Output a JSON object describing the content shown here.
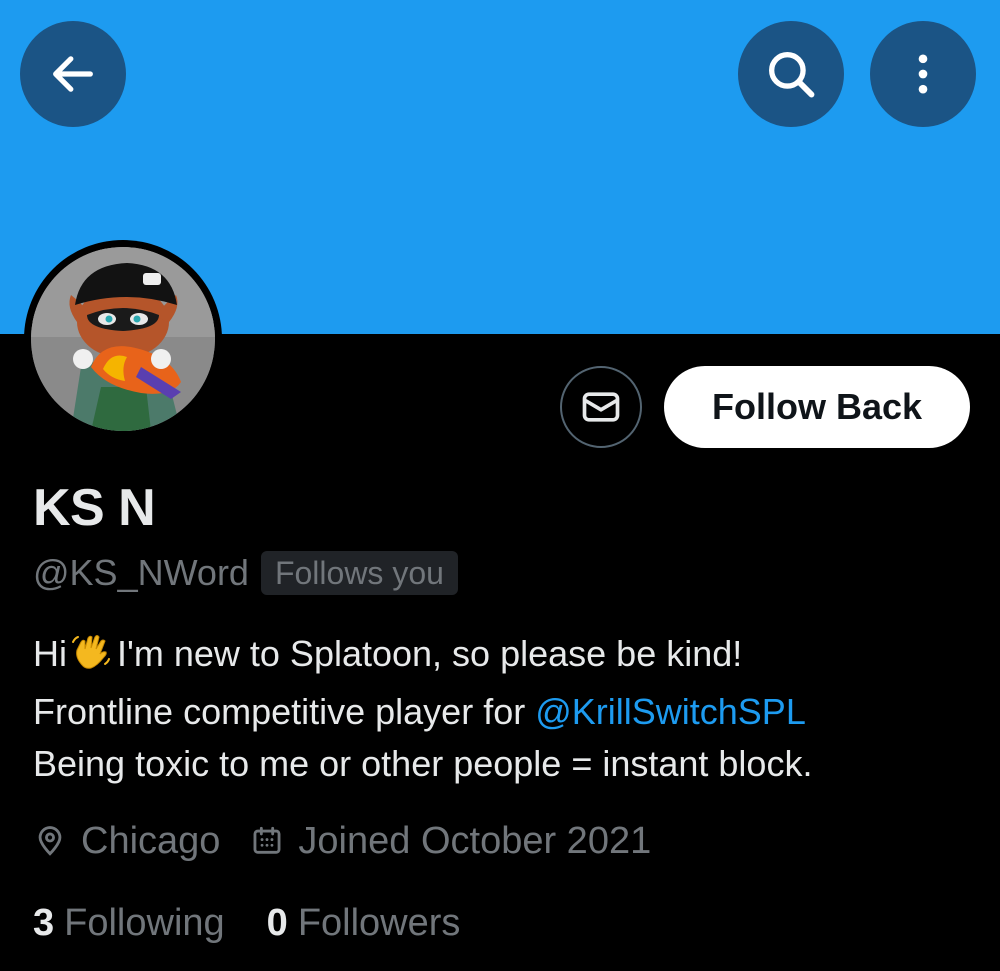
{
  "header": {
    "back_icon": "arrow-left-icon",
    "search_icon": "search-icon",
    "more_icon": "more-vertical-icon",
    "banner_color": "#1d9bf0"
  },
  "profile": {
    "display_name": "KS N",
    "handle": "@KS_NWord",
    "follows_you_badge": "Follows you",
    "follow_button_label": "Follow Back",
    "message_icon": "envelope-icon",
    "bio": {
      "line1_prefix": "Hi",
      "line1_emoji": "waving-hand-icon",
      "line1_suffix": "I'm new to Splatoon, so please be kind!",
      "line2_prefix": "Frontline competitive player for ",
      "line2_mention": "@KrillSwitchSPL",
      "line3": "Being toxic to me or other people = instant block."
    },
    "location": "Chicago",
    "joined": "Joined October 2021",
    "following_count": "3",
    "following_label": "Following",
    "followers_count": "0",
    "followers_label": "Followers"
  },
  "colors": {
    "accent": "#1d9bf0",
    "muted_text": "#71767b",
    "primary_text": "#e7e9ea",
    "button_dark": "#1b5485"
  }
}
